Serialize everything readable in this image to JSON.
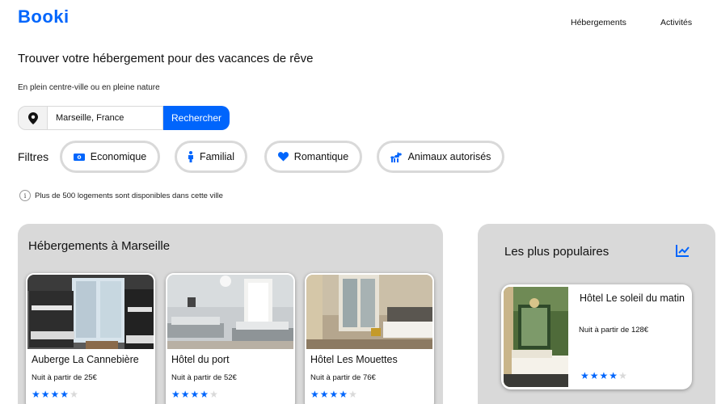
{
  "header": {
    "logo": "Booki",
    "nav": [
      "Hébergements",
      "Activités"
    ]
  },
  "hero": {
    "title": "Trouver votre hébergement pour des vacances de rêve",
    "subtitle": "En plein centre-ville ou en pleine nature"
  },
  "search": {
    "value": "Marseille, France",
    "button_label": "Rechercher",
    "icon": "location-pin-icon"
  },
  "filters": {
    "label": "Filtres",
    "items": [
      {
        "label": "Economique",
        "icon": "money-icon"
      },
      {
        "label": "Familial",
        "icon": "person-icon"
      },
      {
        "label": "Romantique",
        "icon": "heart-icon"
      },
      {
        "label": "Animaux autorisés",
        "icon": "dog-icon"
      }
    ]
  },
  "info": {
    "text": "Plus de 500 logements sont disponibles dans cette ville"
  },
  "hebergements": {
    "title": "Hébergements à Marseille",
    "cards": [
      {
        "name": "Auberge La Cannebière",
        "price": "Nuit à partir de 25€",
        "rating": 4
      },
      {
        "name": "Hôtel du port",
        "price": "Nuit à partir de 52€",
        "rating": 4
      },
      {
        "name": "Hôtel Les Mouettes",
        "price": "Nuit à partir de 76€",
        "rating": 4
      }
    ]
  },
  "populaires": {
    "title": "Les plus populaires",
    "icon": "trend-chart-icon",
    "cards": [
      {
        "name": "Hôtel Le soleil du matin",
        "price": "Nuit à partir de 128€",
        "rating": 4
      }
    ]
  },
  "colors": {
    "accent": "#0065FC",
    "panel": "#D9D9D9",
    "star_off": "#D9D9D9"
  }
}
